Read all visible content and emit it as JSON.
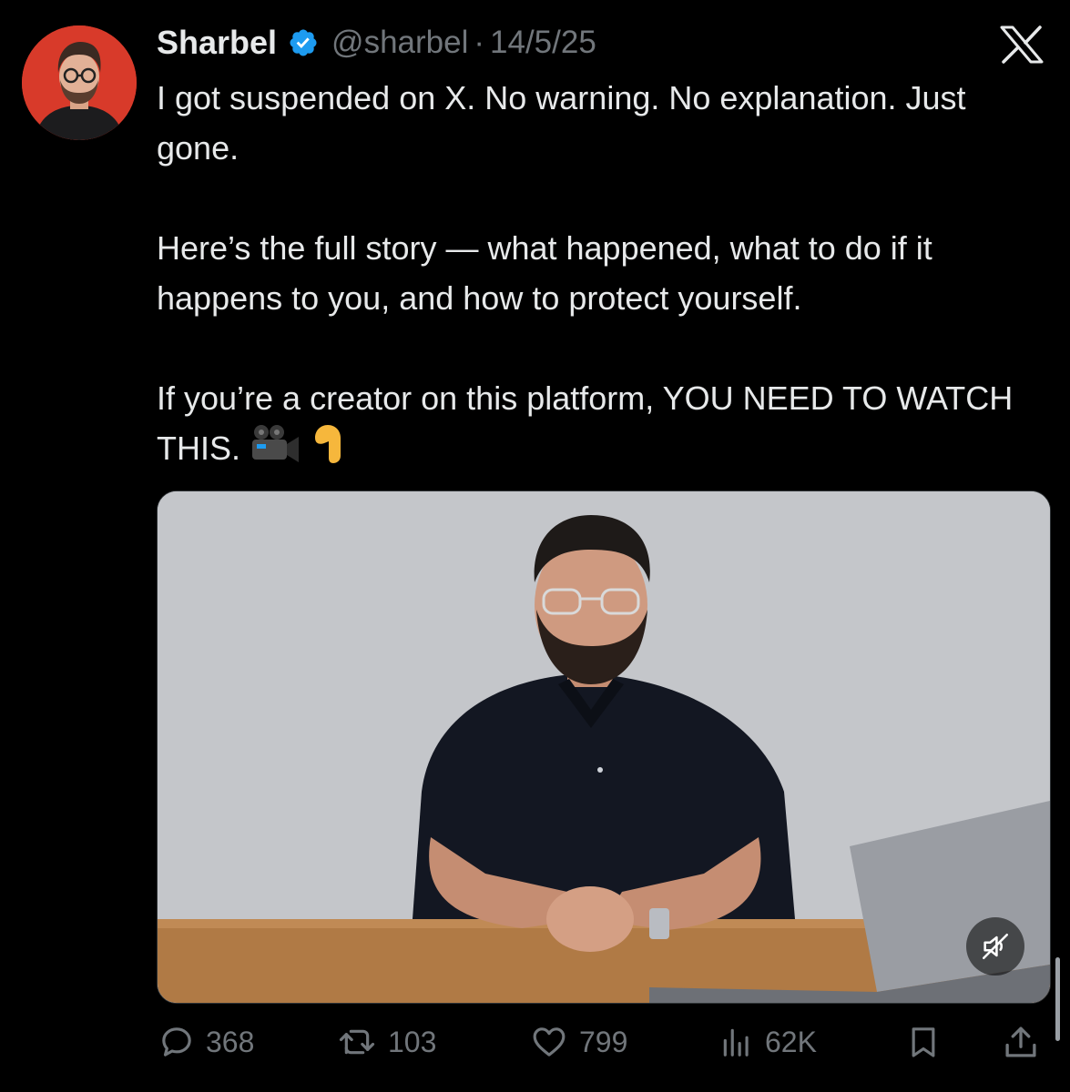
{
  "tweet": {
    "author_name": "Sharbel",
    "handle": "@sharbel",
    "separator": "·",
    "date": "14/5/25",
    "paragraphs": [
      "I got suspended on X. No warning. No explanation. Just gone.",
      "Here’s the full story — what happened, what to do if it happens to you, and how to protect yourself.",
      "If you’re a creator on this platform, YOU NEED TO WATCH THIS."
    ]
  },
  "actions": {
    "replies": "368",
    "reposts": "103",
    "likes": "799",
    "views": "62K"
  },
  "icons": {
    "verified": "verified-badge-icon",
    "platform": "x-logo-icon",
    "camera": "movie-camera-icon",
    "pointing": "pointing-down-icon",
    "mute": "muted-speaker-icon",
    "reply": "reply-icon",
    "repost": "repost-icon",
    "like": "heart-icon",
    "views": "views-chart-icon",
    "bookmark": "bookmark-icon",
    "share": "share-icon"
  },
  "colors": {
    "background": "#000000",
    "text": "#e7e9ea",
    "secondary_text": "#71767b",
    "verified_blue": "#1d9bf0",
    "avatar_bg": "#d83a2a"
  }
}
